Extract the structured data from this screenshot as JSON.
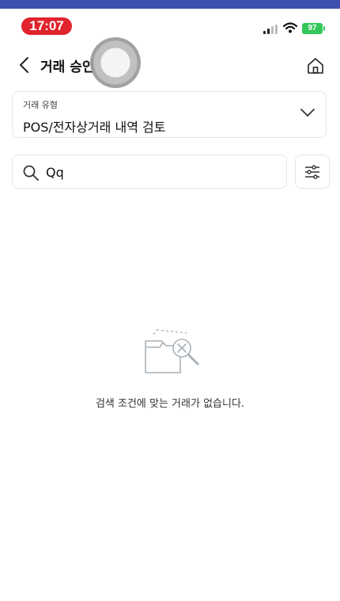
{
  "status_bar": {
    "time": "17:07",
    "battery": "97"
  },
  "header": {
    "title": "거래 승인"
  },
  "transaction_type": {
    "label": "거래 유형",
    "value": "POS/전자상거래 내역 검토"
  },
  "search": {
    "value": "Qq"
  },
  "empty_state": {
    "message": "검색 조건에 맞는 거래가 없습니다."
  },
  "colors": {
    "top_accent": "#3f4fb0",
    "time_pill": "#e0232c",
    "battery": "#34c759"
  }
}
